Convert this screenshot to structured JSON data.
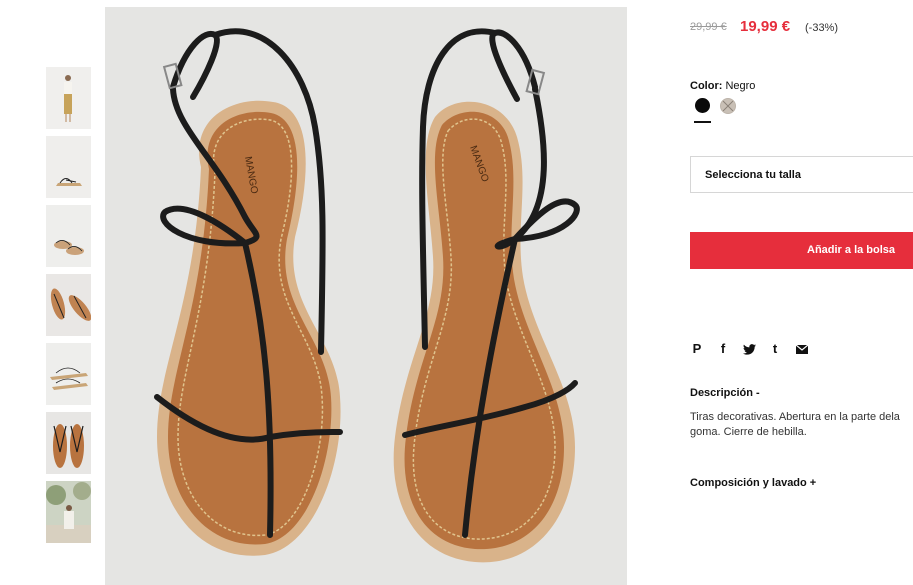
{
  "product": {
    "price_old": "29,99 €",
    "price_new": "19,99 €",
    "discount": "(-33%)",
    "color_label": "Color:",
    "color_value": "Negro",
    "colors": [
      {
        "name": "black",
        "hex": "#0a0a0a"
      },
      {
        "name": "sand",
        "hex": "#c9c0b6"
      }
    ],
    "size_placeholder": "Selecciona tu talla",
    "add_to_bag": "Añadir a la bolsa"
  },
  "share": {
    "icons": [
      "pinterest-icon",
      "facebook-icon",
      "twitter-icon",
      "tumblr-icon",
      "email-icon"
    ],
    "pinterest_glyph": "P",
    "facebook_glyph": "f",
    "twitter_glyph": "t"
  },
  "description": {
    "title": "Descripción -",
    "line1": "Tiras decorativas. Abertura en la parte dela",
    "line2": "goma. Cierre de hebilla."
  },
  "composition": {
    "title": "Composición y lavado +"
  },
  "image": {
    "brand_mark": "MANGO"
  },
  "theme": {
    "accent": "#e62e3c",
    "sole": "#b8733f",
    "strap": "#1c1c1c"
  }
}
